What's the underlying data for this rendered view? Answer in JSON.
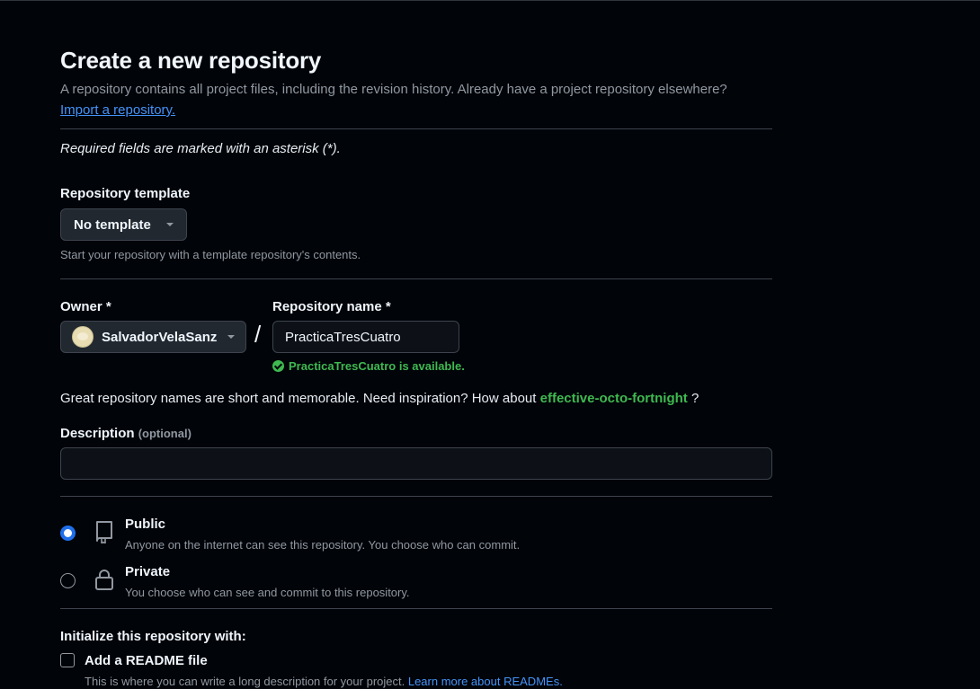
{
  "page": {
    "title": "Create a new repository",
    "subtitle": "A repository contains all project files, including the revision history. Already have a project repository elsewhere?",
    "import_link": "Import a repository.",
    "required_note": "Required fields are marked with an asterisk (*)."
  },
  "template": {
    "label": "Repository template",
    "selected": "No template",
    "help": "Start your repository with a template repository's contents."
  },
  "owner": {
    "label": "Owner *",
    "selected": "SalvadorVelaSanz"
  },
  "separator": "/",
  "repo_name": {
    "label": "Repository name *",
    "value": "PracticaTresCuatro",
    "availability": "PracticaTresCuatro is available."
  },
  "inspiration": {
    "text": "Great repository names are short and memorable. Need inspiration? How about",
    "suggestion": "effective-octo-fortnight",
    "suffix": "?"
  },
  "description": {
    "label": "Description",
    "optional": "(optional)",
    "value": ""
  },
  "visibility": {
    "options": [
      {
        "title": "Public",
        "description": "Anyone on the internet can see this repository. You choose who can commit.",
        "checked": true,
        "icon": "repo-icon"
      },
      {
        "title": "Private",
        "description": "You choose who can see and commit to this repository.",
        "checked": false,
        "icon": "lock-icon"
      }
    ]
  },
  "initialize": {
    "label": "Initialize this repository with:",
    "readme_label": "Add a README file",
    "readme_checked": false,
    "readme_help": "This is where you can write a long description for your project.",
    "readme_link": "Learn more about READMEs."
  },
  "colors": {
    "background": "#010409",
    "accent_link": "#4493f8",
    "success": "#3fb950",
    "radio_selected": "#1f6feb"
  }
}
